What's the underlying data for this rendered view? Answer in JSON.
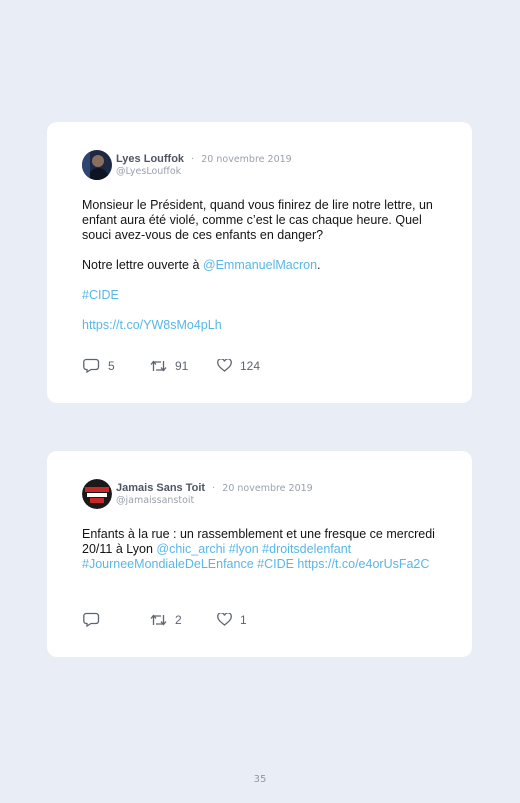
{
  "tweets": [
    {
      "author": "Lyes Louffok",
      "separator": "·",
      "date": "20 novembre 2019",
      "handle": "@LyesLouffok",
      "text1": "Monsieur le Président, quand vous finirez de lire notre lettre, un enfant aura été violé, comme c’est le cas chaque heure. Quel souci avez-vous de ces enfants en danger?",
      "text2_prefix": "Notre lettre ouverte à ",
      "mention": "@EmmanuelMacron",
      "text2_suffix": ".",
      "hashtag": "#CIDE",
      "url": "https://t.co/YW8sMo4pLh",
      "replies": "5",
      "retweets": "91",
      "likes": "124",
      "icons": [
        "reply-icon",
        "retweet-icon",
        "like-icon"
      ]
    },
    {
      "author": "Jamais Sans Toit",
      "separator": "·",
      "date": "20 novembre 2019",
      "handle": "@jamaissanstoit",
      "text_prefix": "Enfants à la rue : un rassemblement et une fresque ce mercredi 20/11 à Lyon ",
      "links": "@chic_archi #lyon #droitsdelenfant #JourneeMondialeDeLEnfance #CIDE https://t.co/e4orUsFa2C",
      "replies": "",
      "retweets": "2",
      "likes": "1",
      "icons": [
        "reply-icon",
        "retweet-icon",
        "like-icon"
      ]
    }
  ],
  "page_number": "35",
  "colors": {
    "background": "#e9edf6",
    "card": "#ffffff",
    "link": "#58b7e6",
    "muted": "#9aa1ad"
  }
}
